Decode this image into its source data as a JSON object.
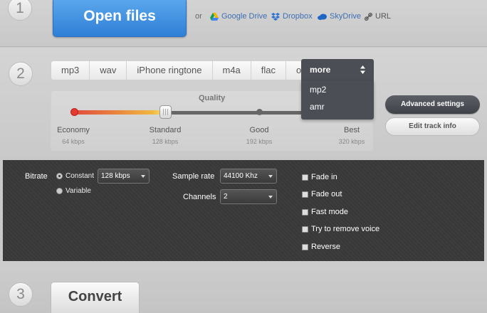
{
  "steps": {
    "one": "1",
    "two": "2",
    "three": "3"
  },
  "open_files": {
    "label": "Open files",
    "or_label": "or",
    "sources": [
      {
        "label": "Google Drive",
        "icon": "google-drive-icon"
      },
      {
        "label": "Dropbox",
        "icon": "dropbox-icon"
      },
      {
        "label": "SkyDrive",
        "icon": "skydrive-icon"
      },
      {
        "label": "URL",
        "icon": "link-icon"
      }
    ]
  },
  "formats": {
    "tabs": [
      "mp3",
      "wav",
      "iPhone ringtone",
      "m4a",
      "flac",
      "ogg"
    ],
    "more_label": "more",
    "more_options": [
      "mp2",
      "amr"
    ]
  },
  "quality": {
    "label": "Quality",
    "selected_level": "Standard",
    "levels": [
      {
        "name": "Economy",
        "kbps": "64 kbps"
      },
      {
        "name": "Standard",
        "kbps": "128 kbps"
      },
      {
        "name": "Good",
        "kbps": "192 kbps"
      },
      {
        "name": "Best",
        "kbps": "320 kbps"
      }
    ]
  },
  "buttons": {
    "advanced_settings": "Advanced settings",
    "edit_track_info": "Edit track info",
    "convert": "Convert"
  },
  "advanced": {
    "bitrate_label": "Bitrate",
    "bitrate_modes": [
      "Constant",
      "Variable"
    ],
    "bitrate_mode_selected": "Constant",
    "bitrate_value": "128 kbps",
    "sample_rate_label": "Sample rate",
    "sample_rate_value": "44100 Khz",
    "channels_label": "Channels",
    "channels_value": "2",
    "checkboxes": [
      "Fade in",
      "Fade out",
      "Fast mode",
      "Try to remove voice",
      "Reverse"
    ]
  },
  "colors": {
    "open_files_blue": "#3d8ee0",
    "dark_panel": "#3b3b3b",
    "quality_start": "#e24a3d",
    "quality_end": "#f0b840"
  }
}
